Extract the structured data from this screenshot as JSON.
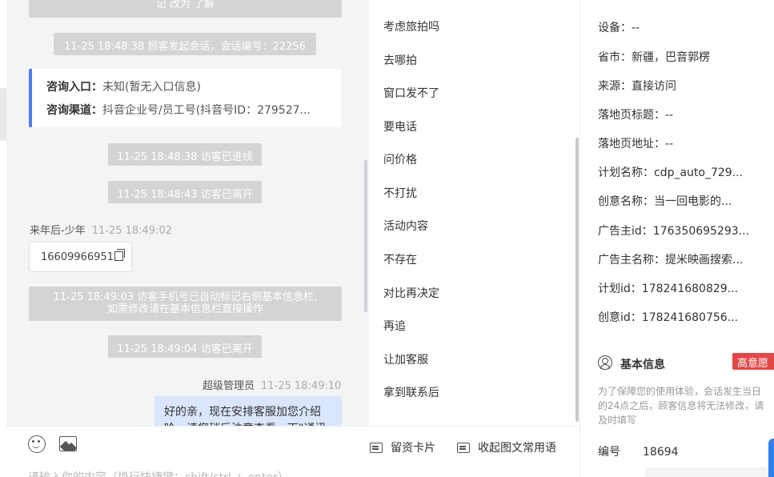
{
  "chat": {
    "top_clipped_line": "记 改为 了解",
    "session_start": "11-25 18:48:38 顾客发起会话，会话编号：22256",
    "entry_card": {
      "entry_key": "咨询入口：",
      "entry_value": "未知(暂无入口信息)",
      "channel_key": "咨询渠道：",
      "channel_value": "抖音企业号/员工号(抖音号ID：279527..."
    },
    "visitor_entered": "11-25 18:48:38 访客已进线",
    "visitor_left_1": "11-25 18:48:43 访客已离开",
    "visitor_sender": {
      "name": "来年后-少年",
      "time": "11-25 18:49:02"
    },
    "phone_message": "16609966951",
    "auto_mark_line1": "11-25 18:49:03 访客手机号已自动标记右侧基本信息栏,",
    "auto_mark_line2": "如需修改请在基本信息栏直接操作",
    "visitor_left_2": "11-25 18:49:04 访客已离开",
    "agent_sender": {
      "name": "超级管理员",
      "time": "11-25 18:49:10"
    },
    "agent_message": "好的亲，现在安排客服加您介绍哈，请您稍后注意查看，下\"通讯"
  },
  "phrases": [
    "考虑旅拍吗",
    "去哪拍",
    "窗口发不了",
    "要电话",
    "问价格",
    "不打扰",
    "活动内容",
    "不存在",
    "对比再决定",
    "再追",
    "让加客服",
    "拿到联系后"
  ],
  "toolbar": {
    "card_label": "留资卡片",
    "collapse_label": "收起图文常用语",
    "input_placeholder": "请输入你的内容（换行快捷键：shift/ctrl + enter）"
  },
  "info": {
    "rows": [
      {
        "key": "设备：",
        "value": "--"
      },
      {
        "key": "省市：",
        "value": "新疆，巴音郭楞"
      },
      {
        "key": "来源：",
        "value": "直接访问"
      },
      {
        "key": "落地页标题：",
        "value": "--"
      },
      {
        "key": "落地页地址：",
        "value": "--"
      },
      {
        "key": "计划名称：",
        "value": "cdp_auto_729..."
      },
      {
        "key": "创意名称：",
        "value": "当一回电影的..."
      },
      {
        "key": "广告主id：",
        "value": "176350695293..."
      },
      {
        "key": "广告主名称：",
        "value": "提米映画搜索..."
      },
      {
        "key": "计划id：",
        "value": "178241680829..."
      },
      {
        "key": "创意id：",
        "value": "178241680756..."
      }
    ],
    "basic_title": "基本信息",
    "intent_badge": "高意愿",
    "notice_line1": "为了保障您的使用体验，会话发生当日",
    "notice_line2": "的24点之后，顾客信息将无法修改，请",
    "notice_line3": "及时填写",
    "id_key": "编号",
    "id_value": "18694"
  }
}
